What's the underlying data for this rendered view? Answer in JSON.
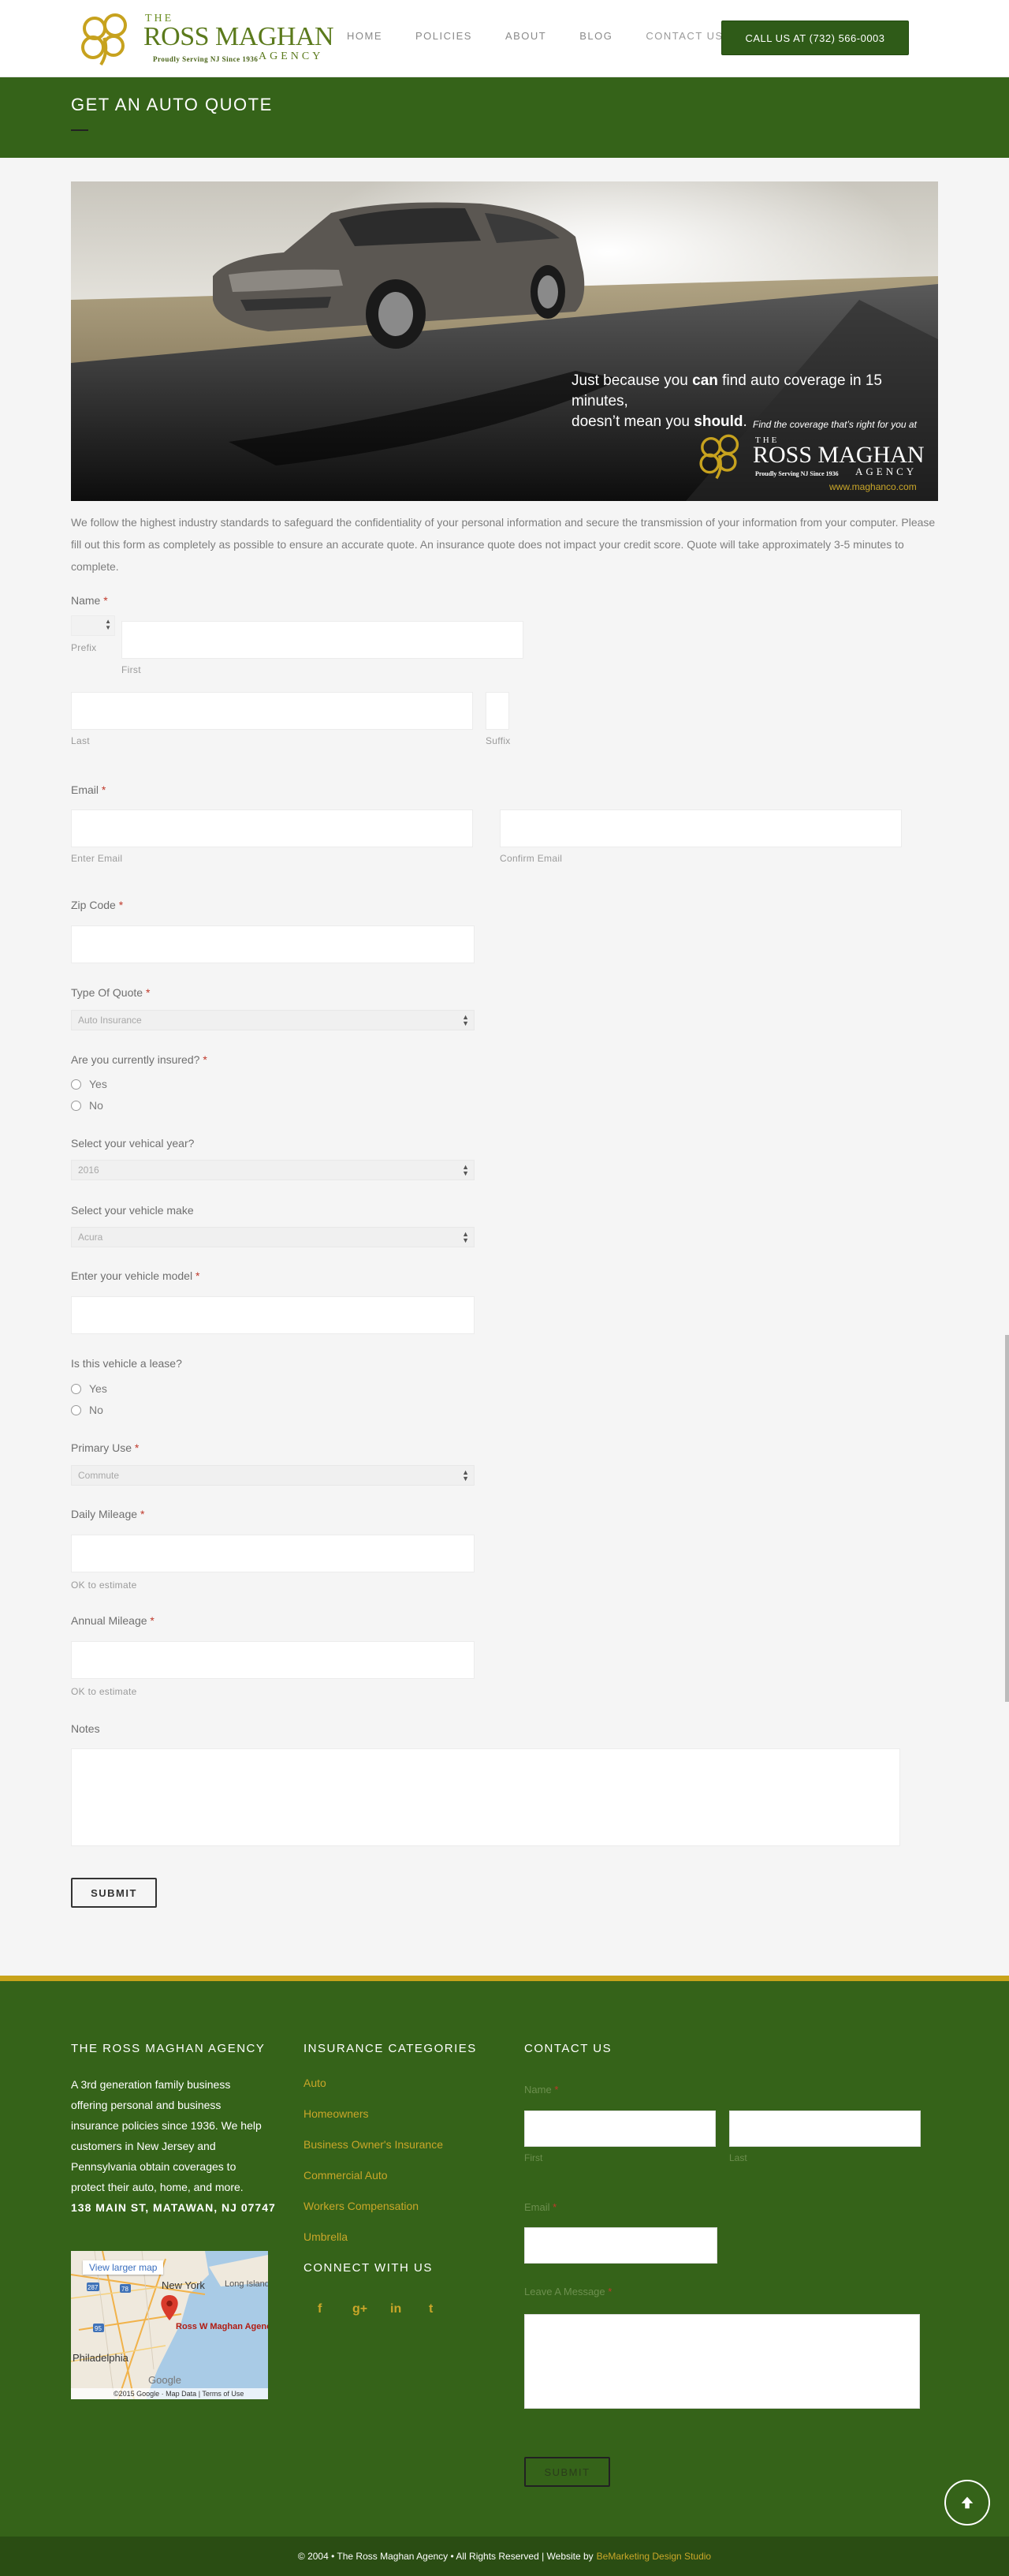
{
  "header": {
    "logo": {
      "the": "THE",
      "name": "ROSS MAGHAN",
      "agency": "AGENCY",
      "tagline": "Proudly Serving NJ Since 1936"
    },
    "nav": [
      {
        "label": "HOME"
      },
      {
        "label": "POLICIES"
      },
      {
        "label": "ABOUT"
      },
      {
        "label": "BLOG"
      },
      {
        "label": "CONTACT US"
      }
    ],
    "call_button": "CALL US AT (732) 566-0003"
  },
  "page_title": "GET AN AUTO QUOTE",
  "hero": {
    "line1_pre": "Just because you ",
    "line1_bold": "can",
    "line1_post": " find auto coverage in 15 minutes,",
    "line2_pre": "doesn’t mean you ",
    "line2_bold": "should",
    "line2_post": ".",
    "find": "Find the coverage that’s right for you at",
    "logo_the": "THE",
    "logo_name": "ROSS MAGHAN",
    "logo_agency": "AGENCY",
    "logo_tagline": "Proudly Serving NJ Since 1936",
    "url": "www.maghanco.com"
  },
  "intro": "We follow the highest industry standards to safeguard the confidentiality of your personal information and secure the transmission of your information from your computer. Please fill out this form as completely as possible to ensure an accurate quote. An insurance quote does not impact your credit score. Quote will take approximately 3-5 minutes to complete.",
  "form": {
    "name": {
      "label": "Name",
      "prefix": "Prefix",
      "first": "First",
      "last": "Last",
      "suffix": "Suffix"
    },
    "email": {
      "label": "Email",
      "enter": "Enter Email",
      "confirm": "Confirm Email"
    },
    "zip": {
      "label": "Zip Code"
    },
    "quote_type": {
      "label": "Type Of Quote",
      "value": "Auto Insurance"
    },
    "insured": {
      "label": "Are you currently insured?",
      "yes": "Yes",
      "no": "No"
    },
    "year": {
      "label": "Select your vehical year?",
      "value": "2016"
    },
    "make": {
      "label": "Select your vehicle make",
      "value": "Acura"
    },
    "model": {
      "label": "Enter your vehicle model"
    },
    "lease": {
      "label": "Is this vehicle a lease?",
      "yes": "Yes",
      "no": "No"
    },
    "primary_use": {
      "label": "Primary Use",
      "value": "Commute"
    },
    "daily": {
      "label": "Daily Mileage",
      "hint": "OK to estimate"
    },
    "annual": {
      "label": "Annual Mileage",
      "hint": "OK to estimate"
    },
    "notes": {
      "label": "Notes"
    },
    "required_mark": "*",
    "submit": "SUBMIT"
  },
  "footer": {
    "about": {
      "title": "THE ROSS MAGHAN AGENCY",
      "text": "A 3rd generation family business offering personal and business insurance policies since 1936. We help customers in New Jersey and Pennsylvania obtain coverages to protect their auto, home, and more.",
      "address": "138 MAIN ST, MATAWAN, NJ 07747"
    },
    "map": {
      "view_larger": "View larger map",
      "new_york": "New York",
      "long_island": "Long Island",
      "pin_label": "Ross W Maghan Agency",
      "philadelphia": "Philadelphia",
      "google": "Google",
      "credits": "©2015 Google · Map Data",
      "terms": "Terms of Use",
      "routes": [
        "78",
        "95",
        "287"
      ]
    },
    "categories": {
      "title": "INSURANCE CATEGORIES",
      "items": [
        "Auto",
        "Homeowners",
        "Business Owner's Insurance",
        "Commercial Auto",
        "Workers Compensation",
        "Umbrella"
      ]
    },
    "connect": {
      "title": "CONNECT WITH US",
      "icons": [
        "facebook-icon",
        "google-plus-icon",
        "linkedin-icon",
        "twitter-icon"
      ]
    },
    "contact": {
      "title": "CONTACT US",
      "name": "Name",
      "first": "First",
      "last": "Last",
      "email": "Email",
      "message": "Leave A Message",
      "required_mark": "*",
      "submit": "SUBMIT"
    },
    "copyright": "© 2004 • The Ross Maghan Agency • All Rights Reserved | Website by",
    "studio": "BeMarketing Design Studio"
  },
  "colors": {
    "green": "#356319",
    "dark_green": "#2a4d13",
    "gold": "#c9a629",
    "required": "#c0392b"
  }
}
